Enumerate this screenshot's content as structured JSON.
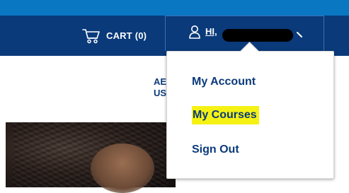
{
  "header": {
    "cart": {
      "label": "CART (0)",
      "icon": "cart-icon"
    },
    "account": {
      "greeting": "HI,",
      "user_icon": "user-icon",
      "chevron_icon": "chevron-down-icon"
    },
    "colors": {
      "topbar": "#0a77c2",
      "navbar": "#0a3a7a",
      "highlight": "#f5f213"
    }
  },
  "background_text": {
    "line1": "AE",
    "line2": "US"
  },
  "account_menu": {
    "items": [
      {
        "label": "My Account",
        "highlighted": false
      },
      {
        "label": "My Courses",
        "highlighted": true
      },
      {
        "label": "Sign Out",
        "highlighted": false
      }
    ]
  }
}
